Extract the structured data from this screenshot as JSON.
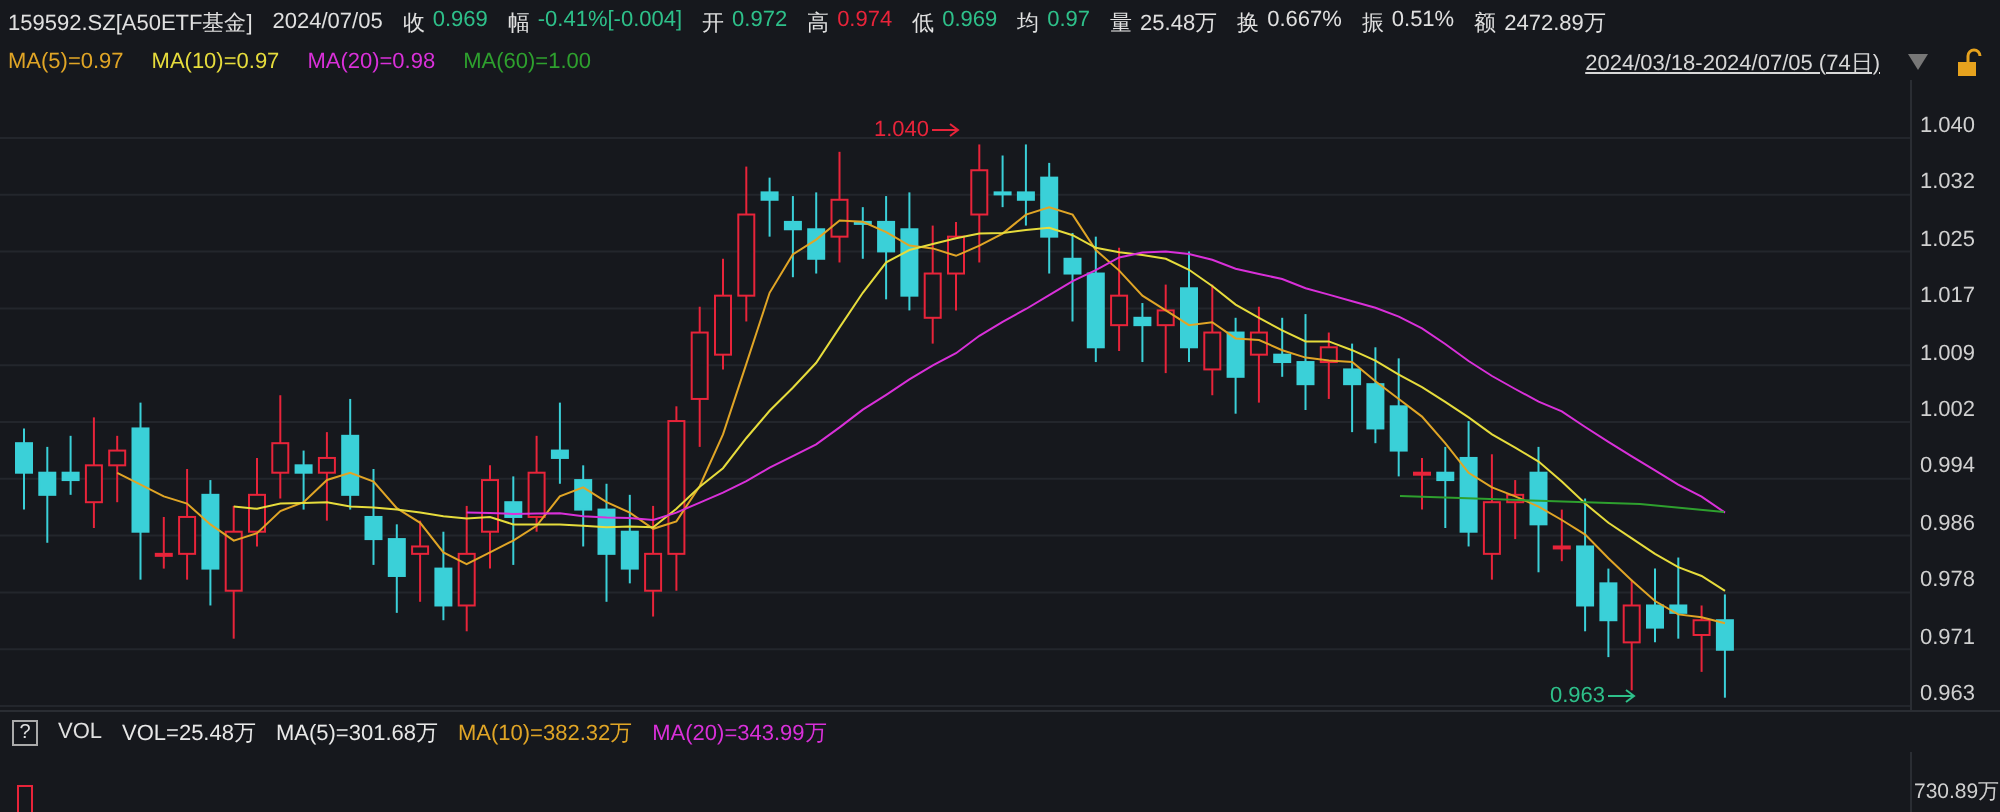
{
  "header": {
    "code": "159592.SZ[A50ETF基金]",
    "date": "2024/07/05",
    "stats": [
      {
        "label": "收",
        "value": "0.969",
        "color": "#2ec08a"
      },
      {
        "label": "幅",
        "value": "-0.41%[-0.004]",
        "color": "#2ec08a"
      },
      {
        "label": "开",
        "value": "0.972",
        "color": "#2ec08a"
      },
      {
        "label": "高",
        "value": "0.974",
        "color": "#e8243a"
      },
      {
        "label": "低",
        "value": "0.969",
        "color": "#2ec08a"
      },
      {
        "label": "均",
        "value": "0.97",
        "color": "#2ec08a"
      },
      {
        "label": "量",
        "value": "25.48万",
        "color": "#e0e0e0"
      },
      {
        "label": "换",
        "value": "0.667%",
        "color": "#e0e0e0"
      },
      {
        "label": "振",
        "value": "0.51%",
        "color": "#e0e0e0"
      },
      {
        "label": "额",
        "value": "2472.89万",
        "color": "#e0e0e0"
      }
    ]
  },
  "ma_legend": [
    {
      "text": "MA(5)=0.97",
      "color": "#e0a526"
    },
    {
      "text": "MA(10)=0.97",
      "color": "#e6dc3c"
    },
    {
      "text": "MA(20)=0.98",
      "color": "#d930d9"
    },
    {
      "text": "MA(60)=1.00",
      "color": "#2ea02e"
    }
  ],
  "date_range": "2024/03/18-2024/07/05 (74日)",
  "price_axis": [
    "1.040",
    "1.032",
    "1.025",
    "1.017",
    "1.009",
    "1.002",
    "0.994",
    "0.986",
    "0.978",
    "0.971",
    "0.963"
  ],
  "annotations": [
    {
      "text": "1.040",
      "kind": "high"
    },
    {
      "text": "0.963",
      "kind": "low"
    }
  ],
  "volume": {
    "help": "?",
    "title": "VOL",
    "legend": [
      {
        "text": "VOL=25.48万",
        "color": "#e8e8e8"
      },
      {
        "text": "MA(5)=301.68万",
        "color": "#e8e8e8"
      },
      {
        "text": "MA(10)=382.32万",
        "color": "#e0a526"
      },
      {
        "text": "MA(20)=343.99万",
        "color": "#d930d9"
      }
    ],
    "axis_max": "730.89万"
  }
}
